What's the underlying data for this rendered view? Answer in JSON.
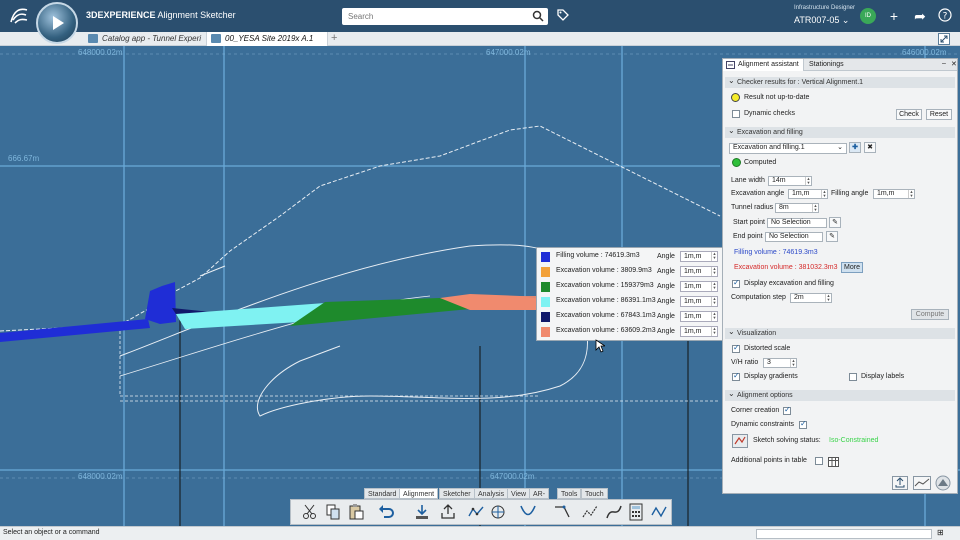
{
  "app": {
    "brand": "3DEXPERIENCE",
    "title": "Alignment Sketcher",
    "logo_text": "3DS"
  },
  "search": {
    "placeholder": "Search"
  },
  "header": {
    "role": "Infrastructure Designer",
    "context": "ATR007-05 ⌄",
    "avatar": "ID"
  },
  "tabs": [
    {
      "label": "Catalog app - Tunnel Experi"
    },
    {
      "label": "00_YESA Site 2019x A.1"
    }
  ],
  "viewport": {
    "coords": [
      "648000.02m",
      "647000.02m",
      "646000.02m",
      "666.67m",
      "648000.02m",
      "647000.02m"
    ]
  },
  "volumes": {
    "rows": [
      {
        "label": "Filling volume : 74619.3m3",
        "color": "#1f2dd6",
        "angle_label": "Angle",
        "angle": "1m,m"
      },
      {
        "label": "Excavation volume : 3809.9m3",
        "color": "#f2a13a",
        "angle_label": "Angle",
        "angle": "1m,m"
      },
      {
        "label": "Excavation volume : 159379m3",
        "color": "#1e8a2c",
        "angle_label": "Angle",
        "angle": "1m,m"
      },
      {
        "label": "Excavation volume : 86391.1m3",
        "color": "#7ff2f2",
        "angle_label": "Angle",
        "angle": "1m,m"
      },
      {
        "label": "Excavation volume : 67843.1m3",
        "color": "#10186a",
        "angle_label": "Angle",
        "angle": "1m,m"
      },
      {
        "label": "Excavation volume : 63609.2m3",
        "color": "#f08a6e",
        "angle_label": "Angle",
        "angle": "1m,m"
      }
    ]
  },
  "panel": {
    "tabs": [
      "Alignment assistant",
      "Stationings"
    ],
    "checker": {
      "header": "Checker results for : Vertical Alignment.1",
      "result": "Result not up-to-date",
      "dynamic_checks": "Dynamic checks",
      "check_btn": "Check",
      "reset_btn": "Reset"
    },
    "excavation": {
      "header": "Excavation and filling",
      "select": "Excavation and filling.1",
      "status": "Computed",
      "lane_width_label": "Lane width",
      "lane_width": "14m",
      "exc_angle_label": "Excavation angle",
      "exc_angle": "1m,m",
      "fill_angle_label": "Filling angle",
      "fill_angle": "1m,m",
      "tunnel_radius_label": "Tunnel radius",
      "tunnel_radius": "8m",
      "start_label": "Start point",
      "start_value": "No Selection",
      "end_label": "End point",
      "end_value": "No Selection",
      "filling_volume": "Filling volume : 74619.3m3",
      "excavation_volume": "Excavation volume : 381032.3m3",
      "more_btn": "More",
      "display_label": "Display excavation and filling",
      "step_label": "Computation step",
      "step_value": "2m",
      "compute_btn": "Compute"
    },
    "visualization": {
      "header": "Visualization",
      "distorted": "Distorted scale",
      "vh_label": "V/H ratio",
      "vh_value": "3",
      "gradients": "Display gradients",
      "labels": "Display labels"
    },
    "options": {
      "header": "Alignment options",
      "corner": "Corner creation",
      "dynamic": "Dynamic constraints",
      "solving_label": "Sketch solving status:",
      "solving_value": "Iso-Constrained",
      "additional": "Additional points in table"
    }
  },
  "bottom_tabs": [
    "Standard",
    "Alignment",
    "Sketcher",
    "Analysis",
    "View",
    "AR-VR",
    "Tools",
    "Touch"
  ],
  "status": {
    "text": "Select an object or a command"
  },
  "colors": {
    "accent": "#2b4f6f",
    "viewport": "#3b6e98",
    "computed": "#2fbf3a",
    "warning": "#f5ec2a"
  }
}
